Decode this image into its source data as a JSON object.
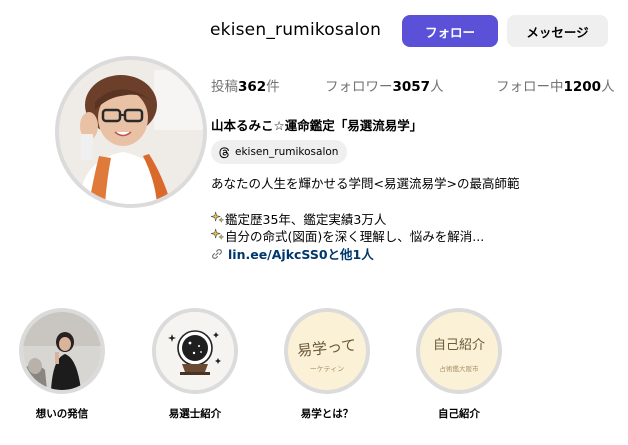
{
  "profile": {
    "username": "ekisen_rumikosalon",
    "follow_label": "フォロー",
    "message_label": "メッセージ"
  },
  "stats": {
    "posts_label": "投稿",
    "posts_count": "362",
    "posts_unit": "件",
    "followers_label": "フォロワー",
    "followers_count": "3057",
    "followers_unit": "人",
    "following_label": "フォロー中",
    "following_count": "1200",
    "following_unit": "人"
  },
  "bio": {
    "full_name": "山本るみこ☆運命鑑定「易選流易学」",
    "threads_handle": "ekisen_rumikosalon",
    "line1": "あなたの人生を輝かせる学問<易選流易学>の最高師範",
    "line2": "鑑定歴35年、鑑定実績3万人",
    "line3": "自分の命式(図面)を深く理解し、悩みを解消...",
    "link_text": "lin.ee/AjkcSS0と他1人"
  },
  "highlights": [
    {
      "label": "想いの発信",
      "icon": "speaker-photo"
    },
    {
      "label": "易選士紹介",
      "icon": "crystal-ball-illustration"
    },
    {
      "label": "易学とは？",
      "icon": "text-card",
      "image_text": "易学って",
      "image_subtext": "ーケティン"
    },
    {
      "label": "自己紹介",
      "icon": "text-card",
      "image_text": "自己紹介",
      "image_subtext": "占術鑑大阪市"
    }
  ],
  "colors": {
    "follow_button": "#5b51d8",
    "secondary_button": "#efefef",
    "muted_text": "#737373",
    "link": "#00376b",
    "ring": "#dbdbdb"
  }
}
